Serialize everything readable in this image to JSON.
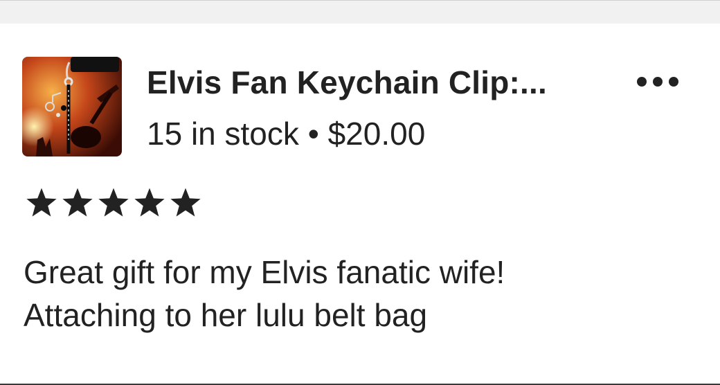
{
  "listing": {
    "title": "Elvis Fan Keychain Clip:...",
    "stock": "15 in stock",
    "separator": "•",
    "price": "$20.00",
    "thumbnail": "keychain-product-photo",
    "more_icon": "more-horizontal-icon"
  },
  "review": {
    "rating": 5,
    "rating_max": 5,
    "star_color": "#222222",
    "lines": [
      "Great gift for my Elvis fanatic wife!",
      "Attaching to her lulu belt bag"
    ]
  }
}
